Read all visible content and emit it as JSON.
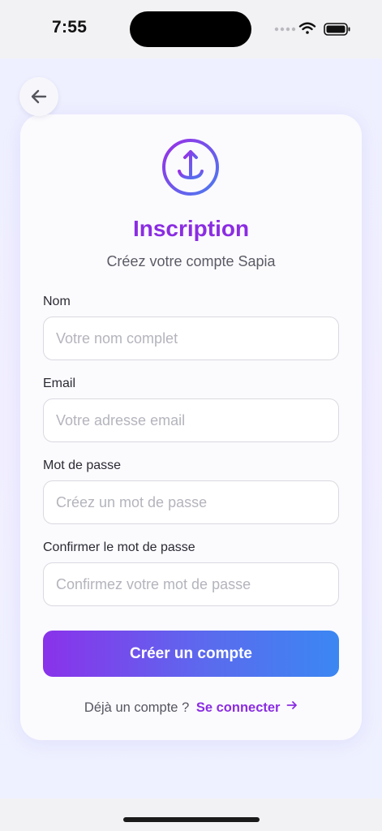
{
  "status_bar": {
    "time": "7:55"
  },
  "header": {
    "back_icon": "arrow-left-icon"
  },
  "card": {
    "logo_icon": "anchor-arrow-circle-icon",
    "title": "Inscription",
    "subtitle": "Créez votre compte Sapia"
  },
  "form": {
    "fields": [
      {
        "label": "Nom",
        "placeholder": "Votre nom complet",
        "value": ""
      },
      {
        "label": "Email",
        "placeholder": "Votre adresse email",
        "value": ""
      },
      {
        "label": "Mot de passe",
        "placeholder": "Créez un mot de passe",
        "value": ""
      },
      {
        "label": "Confirmer le mot de passe",
        "placeholder": "Confirmez votre mot de passe",
        "value": ""
      }
    ],
    "submit_label": "Créer un compte"
  },
  "footer": {
    "prompt": "Déjà un compte ?",
    "link_label": "Se connecter",
    "link_icon": "arrow-right-icon"
  },
  "colors": {
    "accent_purple": "#8b2de2",
    "accent_blue": "#3b87f2"
  }
}
